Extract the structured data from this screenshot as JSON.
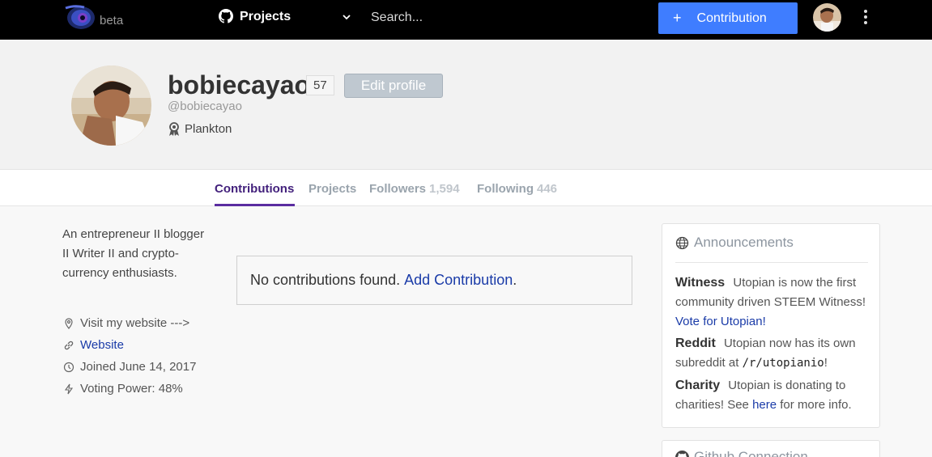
{
  "nav": {
    "beta_label": "beta",
    "projects_label": "Projects",
    "search_placeholder": "Search...",
    "contribution_plus": "+",
    "contribution_label": "Contribution"
  },
  "profile": {
    "username": "bobiecayao",
    "reputation": "57",
    "edit_label": "Edit profile",
    "handle": "@bobiecayao",
    "rank": "Plankton"
  },
  "tabs": [
    {
      "label": "Contributions",
      "count": ""
    },
    {
      "label": "Projects",
      "count": ""
    },
    {
      "label": "Followers",
      "count": "1,594"
    },
    {
      "label": "Following",
      "count": "446"
    }
  ],
  "sidebar": {
    "bio": "An entrepreneur II blogger II Writer II and crypto-currency enthusiasts.",
    "location": "Visit my website --->",
    "website": "Website",
    "joined": "Joined June 14, 2017",
    "voting_power": "Voting Power: 48%"
  },
  "main": {
    "empty_text": "No contributions found.",
    "add_link": "Add Contribution",
    "add_link_suffix": "."
  },
  "announcements": {
    "title": "Announcements",
    "items": [
      {
        "heading": "Witness",
        "text": "Utopian is now the first community driven STEEM Witness!",
        "link": "Vote for Utopian!"
      },
      {
        "heading": "Reddit",
        "text": "Utopian now has its own subreddit at",
        "code": "/r/utopianio",
        "text_after": "!"
      },
      {
        "heading": "Charity",
        "text": "Utopian is donating to charities! See",
        "link": "here",
        "text_after": "for more info."
      }
    ]
  },
  "github_card": {
    "title": "Github Connection"
  },
  "colors": {
    "accent": "#3f7dff",
    "tab_active": "#43217c",
    "link": "#1a3ba8"
  }
}
